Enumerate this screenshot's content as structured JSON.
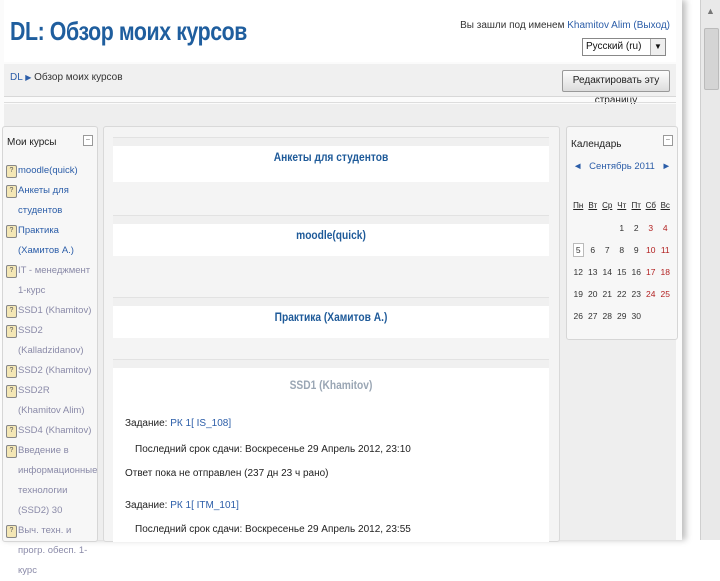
{
  "header": {
    "title": "DL: Обзор моих курсов",
    "login_prefix": "Вы зашли под именем",
    "user_name": "Khamitov Alim",
    "logout_label": "(Выход)",
    "language": "Русский (ru)"
  },
  "navbar": {
    "crumb_home": "DL",
    "crumb_current": "Обзор моих курсов",
    "edit_button": "Редактировать эту страницу"
  },
  "my_courses": {
    "title": "Мои курсы",
    "items": [
      "moodle(quick)",
      "Анкеты для студентов",
      "Практика (Хамитов А.)",
      "IT - менеджмент 1-курс",
      "SSD1 (Khamitov)",
      "SSD2 (Kalladzidanov)",
      "SSD2 (Khamitov)",
      "SSD2R (Khamitov Alim)",
      "SSD4 (Khamitov)",
      "Введение в информационные технологии (SSD2) 30",
      "Выч. техн. и прогр. обесп. 1-курс"
    ]
  },
  "courses": [
    {
      "name": "Анкеты для студентов"
    },
    {
      "name": "moodle(quick)"
    },
    {
      "name": "Практика (Хамитов А.)"
    },
    {
      "name": "SSD1 (Khamitov)"
    }
  ],
  "ssd1": {
    "assign1_label": "Задание:",
    "assign1_link": "РК 1[ IS_108]",
    "assign1_deadline": "Последний срок сдачи: Воскресенье 29 Апрель 2012, 23:10",
    "assign1_status": "Ответ пока не отправлен (237 дн 23 ч рано)",
    "assign2_label": "Задание:",
    "assign2_link": "РК 1[ ITM_101]",
    "assign2_deadline": "Последний срок сдачи: Воскресенье 29 Апрель 2012, 23:55"
  },
  "calendar": {
    "title": "Календарь",
    "month": "Сентябрь 2011",
    "prev": "◄",
    "next": "►",
    "weekdays": [
      "Пн",
      "Вт",
      "Ср",
      "Чт",
      "Пт",
      "Сб",
      "Вс"
    ],
    "weeks": [
      [
        "",
        "",
        "",
        "1",
        "2",
        "3",
        "4"
      ],
      [
        "5",
        "6",
        "7",
        "8",
        "9",
        "10",
        "11"
      ],
      [
        "12",
        "13",
        "14",
        "15",
        "16",
        "17",
        "18"
      ],
      [
        "19",
        "20",
        "21",
        "22",
        "23",
        "24",
        "25"
      ],
      [
        "26",
        "27",
        "28",
        "29",
        "30",
        "",
        ""
      ]
    ],
    "today": "5"
  },
  "colors": {
    "title": "#1f5e9e",
    "link": "#2b5da8",
    "weekend": "#b22222"
  }
}
